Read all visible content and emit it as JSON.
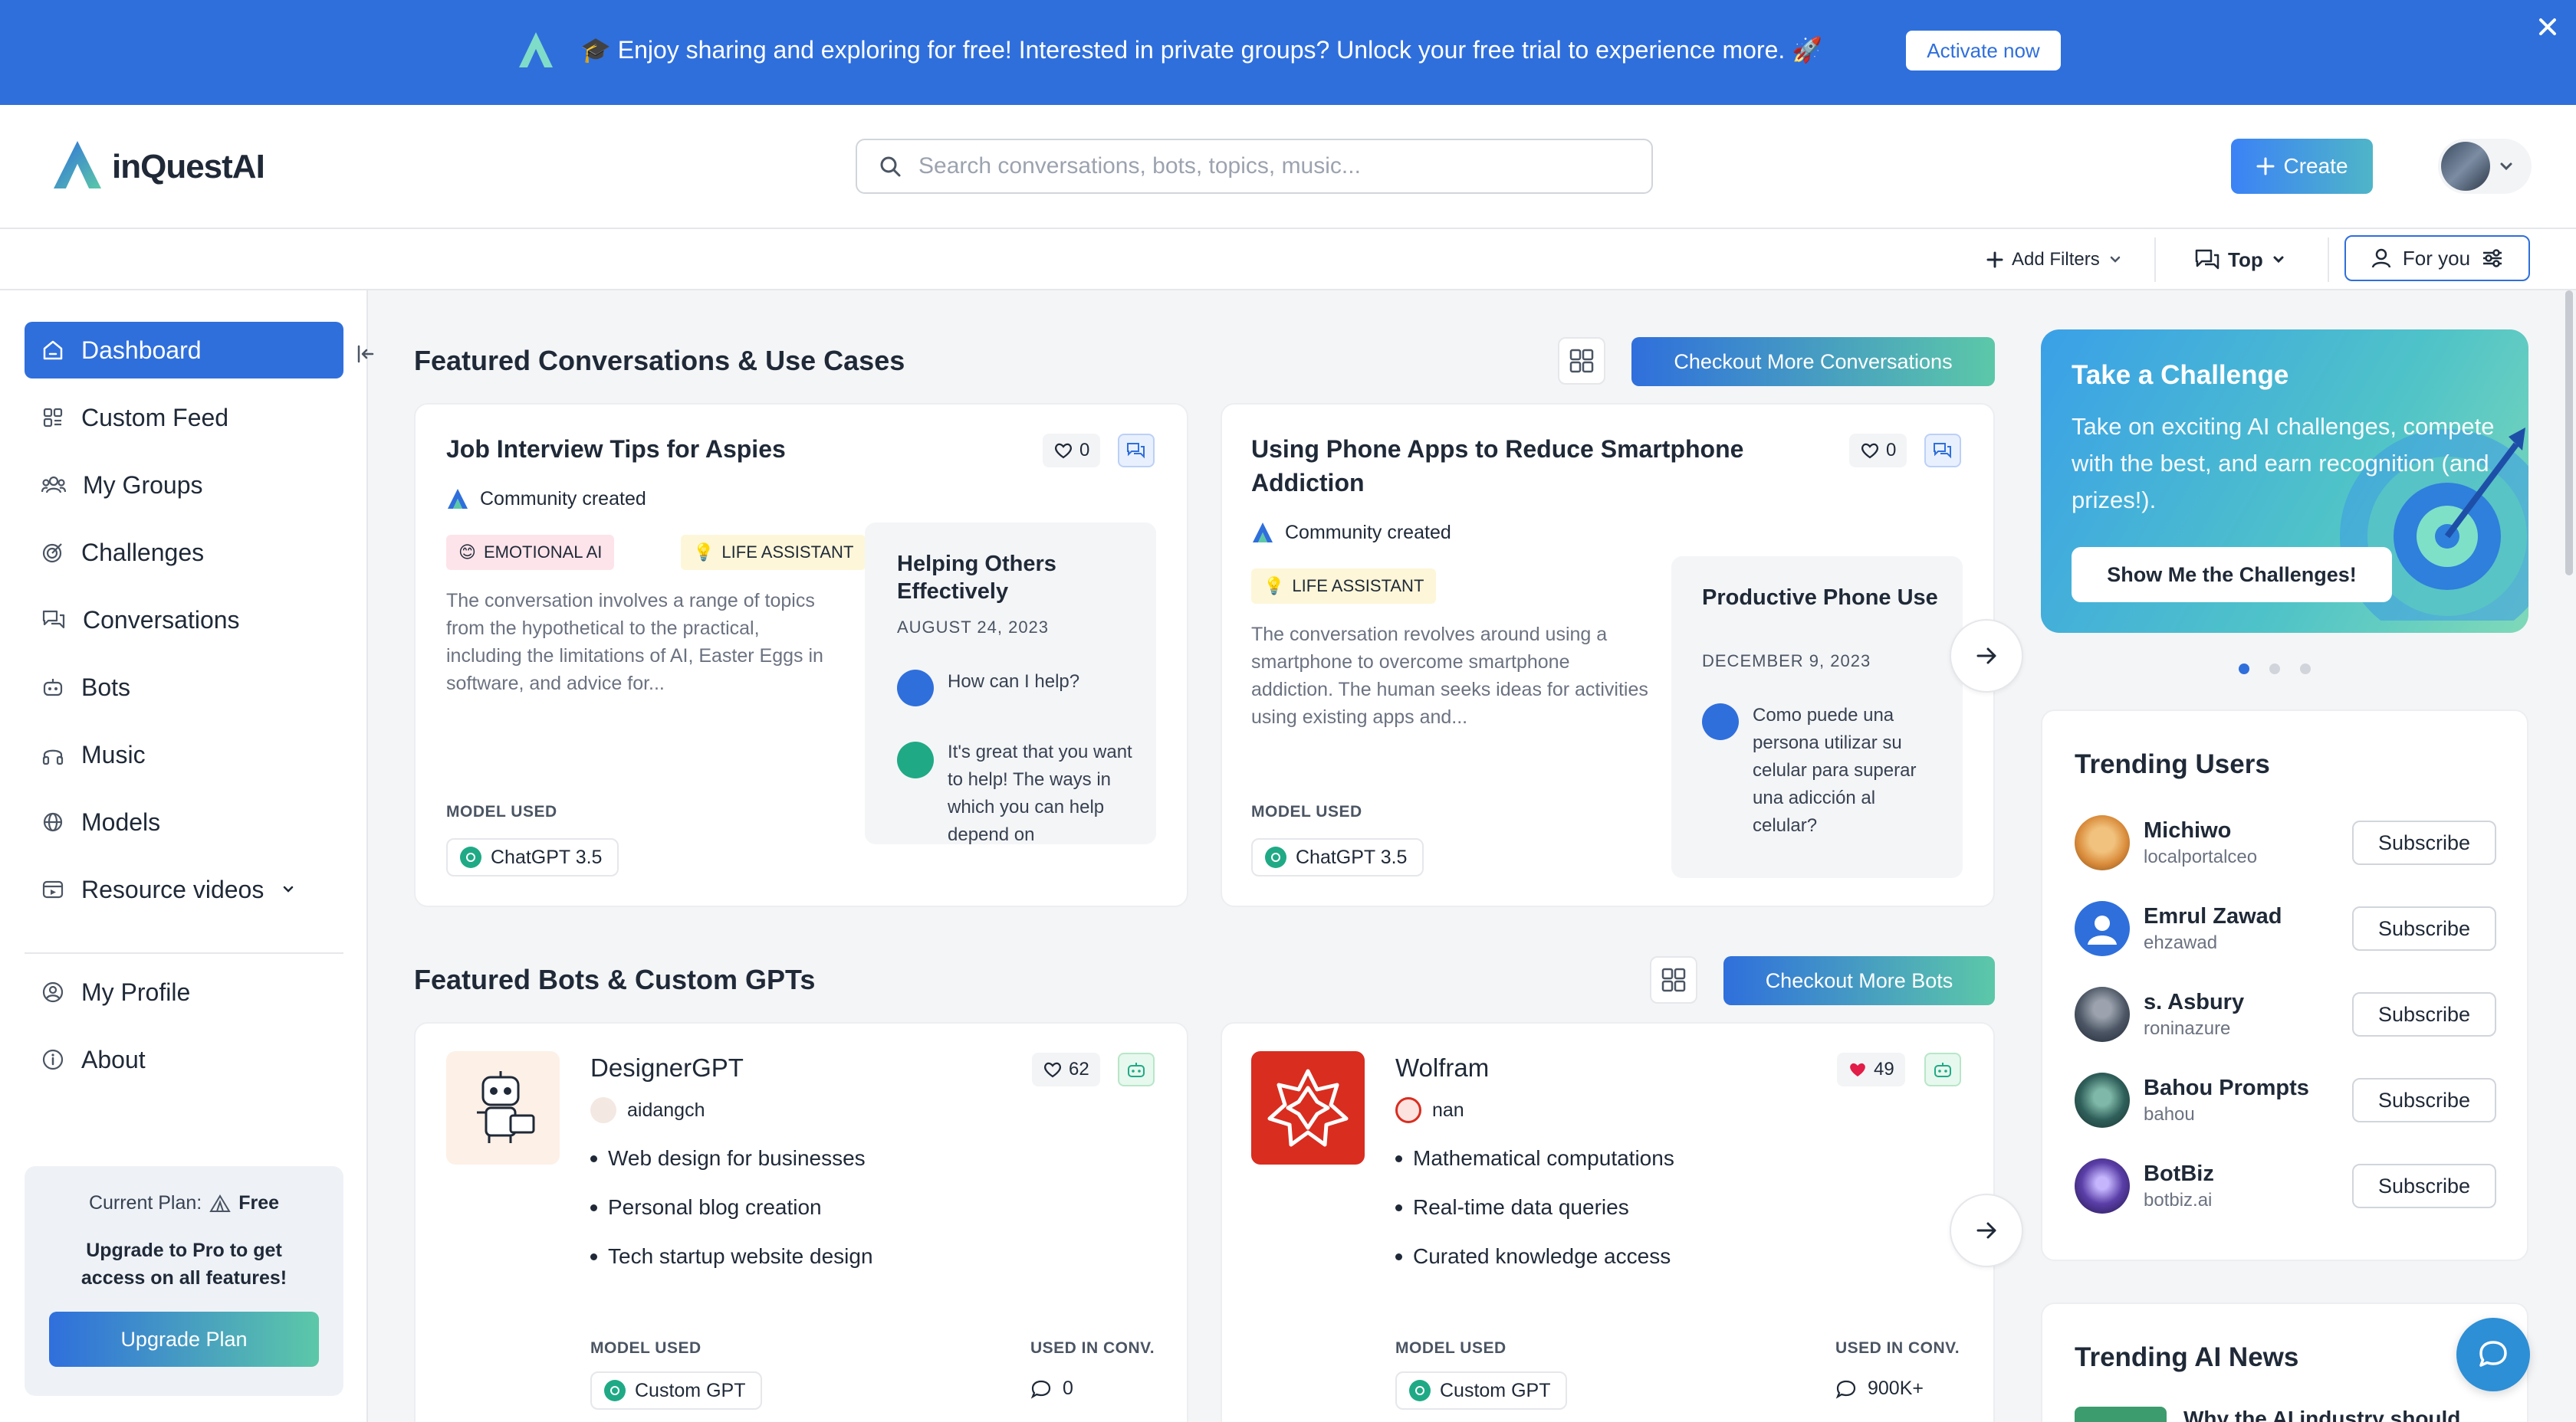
{
  "announcement": {
    "text": "🎓 Enjoy sharing and exploring for free! Interested in private groups? Unlock your free trial to experience more. 🚀",
    "cta": "Activate now"
  },
  "header": {
    "brand": "inQuestAI",
    "search_placeholder": "Search conversations, bots, topics, music...",
    "create_label": "Create"
  },
  "filters": {
    "add_filters": "Add Filters",
    "sort": "Top",
    "feed": "For you"
  },
  "sidebar": {
    "items": [
      {
        "label": "Dashboard",
        "icon": "home-icon",
        "active": true
      },
      {
        "label": "Custom Feed",
        "icon": "grid-icon"
      },
      {
        "label": "My Groups",
        "icon": "users-icon"
      },
      {
        "label": "Challenges",
        "icon": "target-icon"
      },
      {
        "label": "Conversations",
        "icon": "chat-icon"
      },
      {
        "label": "Bots",
        "icon": "bot-icon"
      },
      {
        "label": "Music",
        "icon": "headphones-icon"
      },
      {
        "label": "Models",
        "icon": "globe-icon"
      },
      {
        "label": "Resource videos",
        "icon": "video-icon"
      }
    ],
    "bottom_items": [
      {
        "label": "My Profile",
        "icon": "user-circle-icon"
      },
      {
        "label": "About",
        "icon": "info-icon"
      }
    ],
    "plan": {
      "label": "Current Plan:",
      "value": "Free",
      "upsell": "Upgrade to Pro to get access on all features!",
      "button": "Upgrade Plan"
    }
  },
  "featured_conversations": {
    "title": "Featured Conversations & Use Cases",
    "more_button": "Checkout More Conversations",
    "cards": [
      {
        "title": "Job Interview Tips for Aspies",
        "likes": "0",
        "source": "Community created",
        "tags": [
          {
            "label": "EMOTIONAL AI",
            "emoji": "😊"
          },
          {
            "label": "LIFE ASSISTANT",
            "emoji": "💡"
          }
        ],
        "description": "The conversation involves a range of topics from the hypothetical to the practical, including the limitations of AI, Easter Eggs in software, and advice for...",
        "model_label": "MODEL USED",
        "model": "ChatGPT 3.5",
        "preview": {
          "title": "Helping Others Effectively",
          "date": "AUGUST 24, 2023",
          "user_msg": "How can I help?",
          "bot_msg": "It's great that you want to help! The ways in which you can help depend on"
        }
      },
      {
        "title": "Using Phone Apps to Reduce Smartphone Addiction",
        "likes": "0",
        "source": "Community created",
        "tags": [
          {
            "label": "LIFE ASSISTANT",
            "emoji": "💡"
          }
        ],
        "description": "The conversation revolves around using a smartphone to overcome smartphone addiction. The human seeks ideas for activities using existing apps and...",
        "model_label": "MODEL USED",
        "model": "ChatGPT 3.5",
        "preview": {
          "title": "Productive Phone Use",
          "date": "DECEMBER 9, 2023",
          "user_msg": "Como puede una persona utilizar su celular para superar una adicción al celular?"
        }
      }
    ]
  },
  "featured_bots": {
    "title": "Featured Bots & Custom GPTs",
    "more_button": "Checkout More Bots",
    "cards": [
      {
        "name": "DesignerGPT",
        "likes": "62",
        "author": "aidangch",
        "bullets": [
          "Web design for businesses",
          "Personal blog creation",
          "Tech startup website design"
        ],
        "model_label": "MODEL USED",
        "model": "Custom GPT",
        "used_label": "USED IN CONV.",
        "used": "0"
      },
      {
        "name": "Wolfram",
        "likes": "49",
        "author": "nan",
        "bullets": [
          "Mathematical computations",
          "Real-time data queries",
          "Curated knowledge access"
        ],
        "model_label": "MODEL USED",
        "model": "Custom GPT",
        "used_label": "USED IN CONV.",
        "used": "900K+"
      }
    ]
  },
  "challenge": {
    "title": "Take a Challenge",
    "text": "Take on exciting AI challenges, compete with the best, and earn recognition (and prizes!).",
    "button": "Show Me the Challenges!"
  },
  "trending_users": {
    "title": "Trending Users",
    "subscribe_label": "Subscribe",
    "users": [
      {
        "name": "Michiwo",
        "handle": "localportalceo"
      },
      {
        "name": "Emrul Zawad",
        "handle": "ehzawad"
      },
      {
        "name": "s. Asbury",
        "handle": "roninazure"
      },
      {
        "name": "Bahou Prompts",
        "handle": "bahou"
      },
      {
        "name": "BotBiz",
        "handle": "botbiz.ai"
      }
    ]
  },
  "trending_news": {
    "title": "Trending AI News",
    "first_headline": "Why the AI industry should"
  },
  "colors": {
    "primary": "#2f6fdc",
    "accent_green": "#5cc8a8",
    "gpt_green": "#1faa85",
    "wolfram_red": "#d92d20"
  }
}
